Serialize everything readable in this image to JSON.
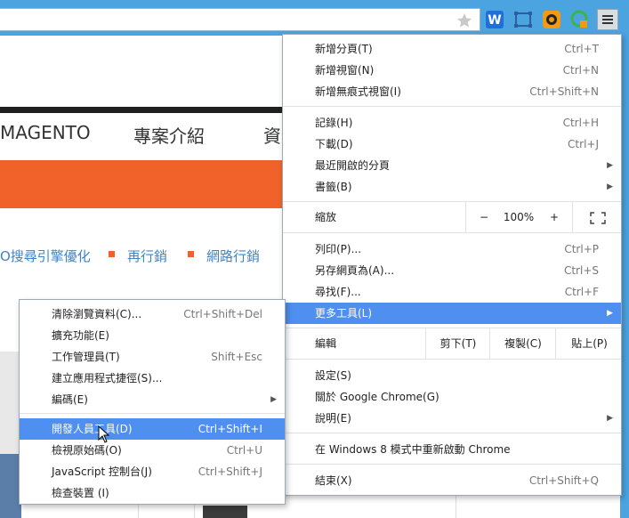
{
  "browser": {
    "icons": [
      "star-icon",
      "w-extension-icon",
      "window-extension-icon",
      "orange-extension-icon",
      "green-extension-icon",
      "chrome-menu-icon"
    ]
  },
  "webpage": {
    "nav": [
      "MAGENTO",
      "專案介紹",
      "資"
    ],
    "subnav": [
      "O搜尋引擎優化",
      "再行銷",
      "網路行銷"
    ],
    "accent": "#f0622a"
  },
  "main_menu": {
    "group1": [
      {
        "label": "新增分頁(T)",
        "shortcut": "Ctrl+T"
      },
      {
        "label": "新增視窗(N)",
        "shortcut": "Ctrl+N"
      },
      {
        "label": "新增無痕式視窗(I)",
        "shortcut": "Ctrl+Shift+N"
      }
    ],
    "group2": [
      {
        "label": "記錄(H)",
        "shortcut": "Ctrl+H"
      },
      {
        "label": "下載(D)",
        "shortcut": "Ctrl+J"
      },
      {
        "label": "最近開啟的分頁",
        "shortcut": ""
      },
      {
        "label": "書籤(B)",
        "shortcut": ""
      }
    ],
    "zoom": {
      "label": "縮放",
      "minus": "−",
      "value": "100%",
      "plus": "+"
    },
    "group3": [
      {
        "label": "列印(P)...",
        "shortcut": "Ctrl+P"
      },
      {
        "label": "另存網頁為(A)...",
        "shortcut": "Ctrl+S"
      },
      {
        "label": "尋找(F)...",
        "shortcut": "Ctrl+F"
      },
      {
        "label": "更多工具(L)",
        "shortcut": ""
      }
    ],
    "edit": {
      "label": "編輯",
      "cut": "剪下(T)",
      "copy": "複製(C)",
      "paste": "貼上(P)"
    },
    "group4": [
      {
        "label": "設定(S)",
        "shortcut": ""
      },
      {
        "label": "關於 Google Chrome(G)",
        "shortcut": ""
      },
      {
        "label": "說明(E)",
        "shortcut": ""
      }
    ],
    "restart": {
      "label": "在 Windows 8 模式中重新啟動 Chrome"
    },
    "exit": {
      "label": "結束(X)",
      "shortcut": "Ctrl+Shift+Q"
    }
  },
  "sub_menu": {
    "group1": [
      {
        "label": "清除瀏覽資料(C)...",
        "shortcut": "Ctrl+Shift+Del"
      },
      {
        "label": "擴充功能(E)",
        "shortcut": ""
      },
      {
        "label": "工作管理員(T)",
        "shortcut": "Shift+Esc"
      },
      {
        "label": "建立應用程式捷徑(S)...",
        "shortcut": ""
      },
      {
        "label": "編碼(E)",
        "shortcut": ""
      }
    ],
    "group2": [
      {
        "label": "開發人員工具(D)",
        "shortcut": "Ctrl+Shift+I"
      },
      {
        "label": "檢視原始碼(O)",
        "shortcut": "Ctrl+U"
      },
      {
        "label": "JavaScript 控制台(J)",
        "shortcut": "Ctrl+Shift+J"
      },
      {
        "label": "檢查裝置 (I)",
        "shortcut": ""
      }
    ]
  },
  "colors": {
    "highlight": "#4f8ff0",
    "frame": "#4ba3e0"
  }
}
